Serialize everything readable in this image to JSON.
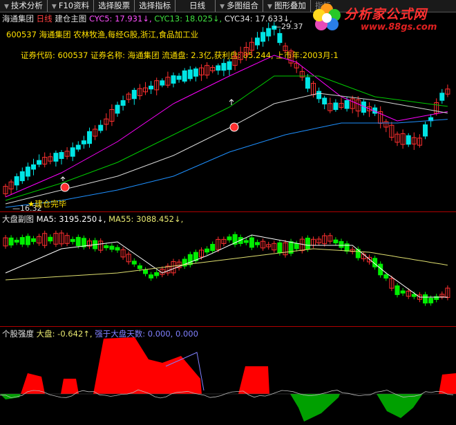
{
  "toolbar": {
    "buttons": [
      "技术分析",
      "F10资料",
      "选择股票",
      "选择指标",
      "日线",
      "多图组合",
      "图形叠加"
    ],
    "behind_logo": "指标"
  },
  "logo": {
    "title": "分析家公式网",
    "url": "www.88gs.com"
  },
  "main_chart": {
    "stock_name": "海通集团",
    "period": "日线",
    "chart_name": "建仓主图",
    "cyc5_label": "CYC5: 17.931↓,",
    "cyc13_label": "CYC13: 18.025↓,",
    "cyc34_label": "CYC34: 17.633↓,",
    "info_line": "600537 海通集团 农林牧渔,每经G股,浙江,食品加工业",
    "code_line": "证券代码: 600537 证券名称: 海通集团  流通盘: 2.3亿,获利盘: 85.244, 上市年:2003月:1",
    "high_label": "29.37",
    "low_label": "16.32",
    "completion_label": "★建仓完毕",
    "colors": {
      "cyc5": "#ff00ff",
      "cyc13": "#00cc00",
      "cyc34": "#d8d8d8",
      "cyc_long": "#1e90ff",
      "up": "#ff3030",
      "down": "#00e5e5"
    }
  },
  "market_panel": {
    "title": "大盘副图",
    "ma5_label": "MA5: 3195.250↓,",
    "ma55_label": "MA55: 3088.452↓,",
    "colors": {
      "up": "#ff3030",
      "down": "#00ee00",
      "ma5": "#ffffff",
      "ma55": "#e0e070"
    }
  },
  "strength_panel": {
    "title": "个股强度",
    "market_label": "大盘: -0.642↑,",
    "stronger_label": "强于大盘天数: 0.000, 0.000",
    "colors": {
      "positive": "#ff0000",
      "negative": "#00a000",
      "line": "#8080ff"
    }
  }
}
